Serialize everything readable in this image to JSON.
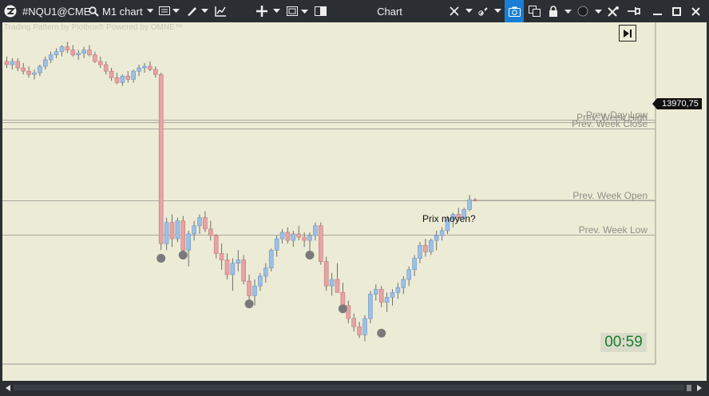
{
  "toolbar": {
    "symbol": "#NQU1@CME",
    "timeframe": "M1 chart",
    "window_title": "Chart"
  },
  "chart": {
    "watermark": "Trading Pattern by Plotbox®  Powered by OMNE™",
    "ref_lines": [
      {
        "label": "Prev. Day Low",
        "price": 14020.0
      },
      {
        "label": "Prev. Week High",
        "price": 14018.5
      },
      {
        "label": "Prev. Week Close",
        "price": 14014.5
      },
      {
        "label": "Prev. Week Open",
        "price": 13970.75
      },
      {
        "label": "Prev. Week Low",
        "price": 13949.5
      }
    ],
    "current_price": "13970,75",
    "annotation": "Prix moyen?",
    "countdown": "00:59",
    "colors": {
      "bull": "#9cc0e6",
      "bear": "#e6a4a4",
      "marker": "#7a7a7a",
      "background": "#ecebd6"
    },
    "candles": [
      [
        14056,
        14059,
        14052,
        14054
      ],
      [
        14054,
        14058,
        14051,
        14056
      ],
      [
        14056,
        14058,
        14050,
        14052
      ],
      [
        14052,
        14055,
        14048,
        14050
      ],
      [
        14050,
        14053,
        14046,
        14048
      ],
      [
        14048,
        14051,
        14045,
        14049
      ],
      [
        14049,
        14054,
        14047,
        14053
      ],
      [
        14053,
        14059,
        14051,
        14057
      ],
      [
        14057,
        14062,
        14055,
        14060
      ],
      [
        14060,
        14064,
        14058,
        14062
      ],
      [
        14062,
        14066,
        14059,
        14065
      ],
      [
        14065,
        14068,
        14061,
        14063
      ],
      [
        14063,
        14066,
        14059,
        14060
      ],
      [
        14060,
        14063,
        14057,
        14061
      ],
      [
        14061,
        14065,
        14058,
        14063
      ],
      [
        14063,
        14066,
        14059,
        14060
      ],
      [
        14060,
        14062,
        14055,
        14056
      ],
      [
        14056,
        14059,
        14052,
        14054
      ],
      [
        14054,
        14056,
        14048,
        14050
      ],
      [
        14050,
        14052,
        14044,
        14046
      ],
      [
        14046,
        14049,
        14042,
        14043
      ],
      [
        14043,
        14048,
        14041,
        14047
      ],
      [
        14047,
        14050,
        14043,
        14045
      ],
      [
        14045,
        14051,
        14043,
        14050
      ],
      [
        14050,
        14054,
        14047,
        14052
      ],
      [
        14052,
        14055,
        14049,
        14053
      ],
      [
        14053,
        14056,
        14050,
        14051
      ],
      [
        14051,
        14053,
        14046,
        14048
      ],
      [
        14048,
        14049,
        13940,
        13944
      ],
      [
        13944,
        13960,
        13940,
        13957
      ],
      [
        13957,
        13962,
        13942,
        13947
      ],
      [
        13947,
        13960,
        13945,
        13958
      ],
      [
        13958,
        13961,
        13936,
        13940
      ],
      [
        13940,
        13952,
        13930,
        13950
      ],
      [
        13950,
        13958,
        13946,
        13955
      ],
      [
        13955,
        13962,
        13950,
        13960
      ],
      [
        13960,
        13964,
        13951,
        13953
      ],
      [
        13953,
        13958,
        13946,
        13949
      ],
      [
        13949,
        13950,
        13935,
        13938
      ],
      [
        13938,
        13944,
        13928,
        13934
      ],
      [
        13934,
        13938,
        13922,
        13925
      ],
      [
        13925,
        13935,
        13915,
        13932
      ],
      [
        13932,
        13940,
        13927,
        13934
      ],
      [
        13934,
        13937,
        13919,
        13921
      ],
      [
        13921,
        13925,
        13908,
        13912
      ],
      [
        13912,
        13922,
        13906,
        13918
      ],
      [
        13918,
        13926,
        13915,
        13924
      ],
      [
        13924,
        13932,
        13920,
        13929
      ],
      [
        13929,
        13941,
        13927,
        13940
      ],
      [
        13940,
        13949,
        13936,
        13947
      ],
      [
        13947,
        13953,
        13944,
        13951
      ],
      [
        13951,
        13954,
        13944,
        13946
      ],
      [
        13946,
        13952,
        13942,
        13950
      ],
      [
        13950,
        13955,
        13946,
        13948
      ],
      [
        13948,
        13951,
        13942,
        13946
      ],
      [
        13946,
        13951,
        13937,
        13949
      ],
      [
        13949,
        13957,
        13946,
        13955
      ],
      [
        13955,
        13957,
        13931,
        13933
      ],
      [
        13933,
        13936,
        13915,
        13918
      ],
      [
        13918,
        13926,
        13912,
        13922
      ],
      [
        13922,
        13932,
        13916,
        13914
      ],
      [
        13914,
        13920,
        13904,
        13906
      ],
      [
        13906,
        13909,
        13895,
        13898
      ],
      [
        13898,
        13901,
        13890,
        13893
      ],
      [
        13893,
        13896,
        13886,
        13888
      ],
      [
        13888,
        13900,
        13884,
        13898
      ],
      [
        13898,
        13915,
        13895,
        13913
      ],
      [
        13913,
        13919,
        13909,
        13916
      ],
      [
        13916,
        13918,
        13905,
        13908
      ],
      [
        13908,
        13914,
        13902,
        13911
      ],
      [
        13911,
        13916,
        13906,
        13914
      ],
      [
        13914,
        13920,
        13910,
        13917
      ],
      [
        13917,
        13924,
        13913,
        13922
      ],
      [
        13922,
        13930,
        13918,
        13928
      ],
      [
        13928,
        13937,
        13924,
        13935
      ],
      [
        13935,
        13945,
        13932,
        13943
      ],
      [
        13943,
        13947,
        13936,
        13939
      ],
      [
        13939,
        13947,
        13937,
        13946
      ],
      [
        13946,
        13952,
        13940,
        13949
      ],
      [
        13949,
        13954,
        13946,
        13952
      ],
      [
        13952,
        13961,
        13950,
        13959
      ],
      [
        13959,
        13963,
        13954,
        13962
      ],
      [
        13962,
        13966,
        13958,
        13960
      ],
      [
        13960,
        13966,
        13959,
        13965
      ],
      [
        13965,
        13974,
        13964,
        13971
      ],
      [
        13971,
        13972,
        13970,
        13970.75
      ]
    ],
    "swing_markers": [
      {
        "candle": 28,
        "price": 13935
      },
      {
        "candle": 32,
        "price": 13937
      },
      {
        "candle": 44,
        "price": 13907
      },
      {
        "candle": 55,
        "price": 13937
      },
      {
        "candle": 61,
        "price": 13904
      },
      {
        "candle": 68,
        "price": 13889
      }
    ],
    "y_range": [
      13870,
      14080
    ]
  }
}
